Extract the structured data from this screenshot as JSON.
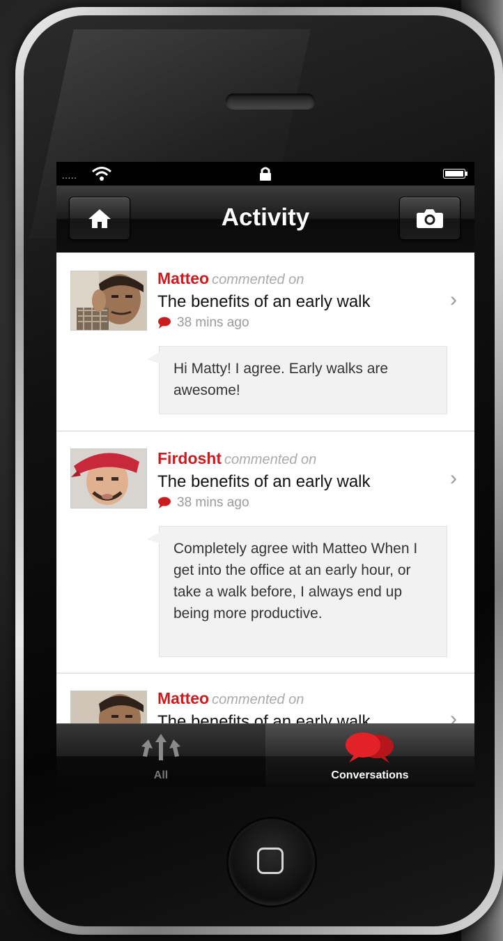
{
  "status_bar": {
    "signal": "....."
  },
  "nav": {
    "title": "Activity"
  },
  "feed": [
    {
      "author": "Matteo",
      "action": "commented on",
      "post_title": "The benefits of an early walk",
      "time": "38 mins ago",
      "comment": "Hi Matty!  I agree.  Early walks are awesome!"
    },
    {
      "author": "Firdosht",
      "action": "commented on",
      "post_title": "The benefits of an early walk",
      "time": "38 mins ago",
      "comment": "Completely agree with Matteo When I get into the office at an early hour, or take a walk before, I always end up being more productive."
    },
    {
      "author": "Matteo",
      "action": "commented on",
      "post_title": "The benefits of an early walk"
    }
  ],
  "tabs": [
    {
      "label": "All",
      "selected": false,
      "icon": "all-arrows-icon"
    },
    {
      "label": "Conversations",
      "selected": true,
      "icon": "conversations-icon"
    }
  ],
  "colors": {
    "accent": "#cc1b1f",
    "nav_background": "#1b1b1b",
    "bubble_background": "#f2f2f2"
  }
}
